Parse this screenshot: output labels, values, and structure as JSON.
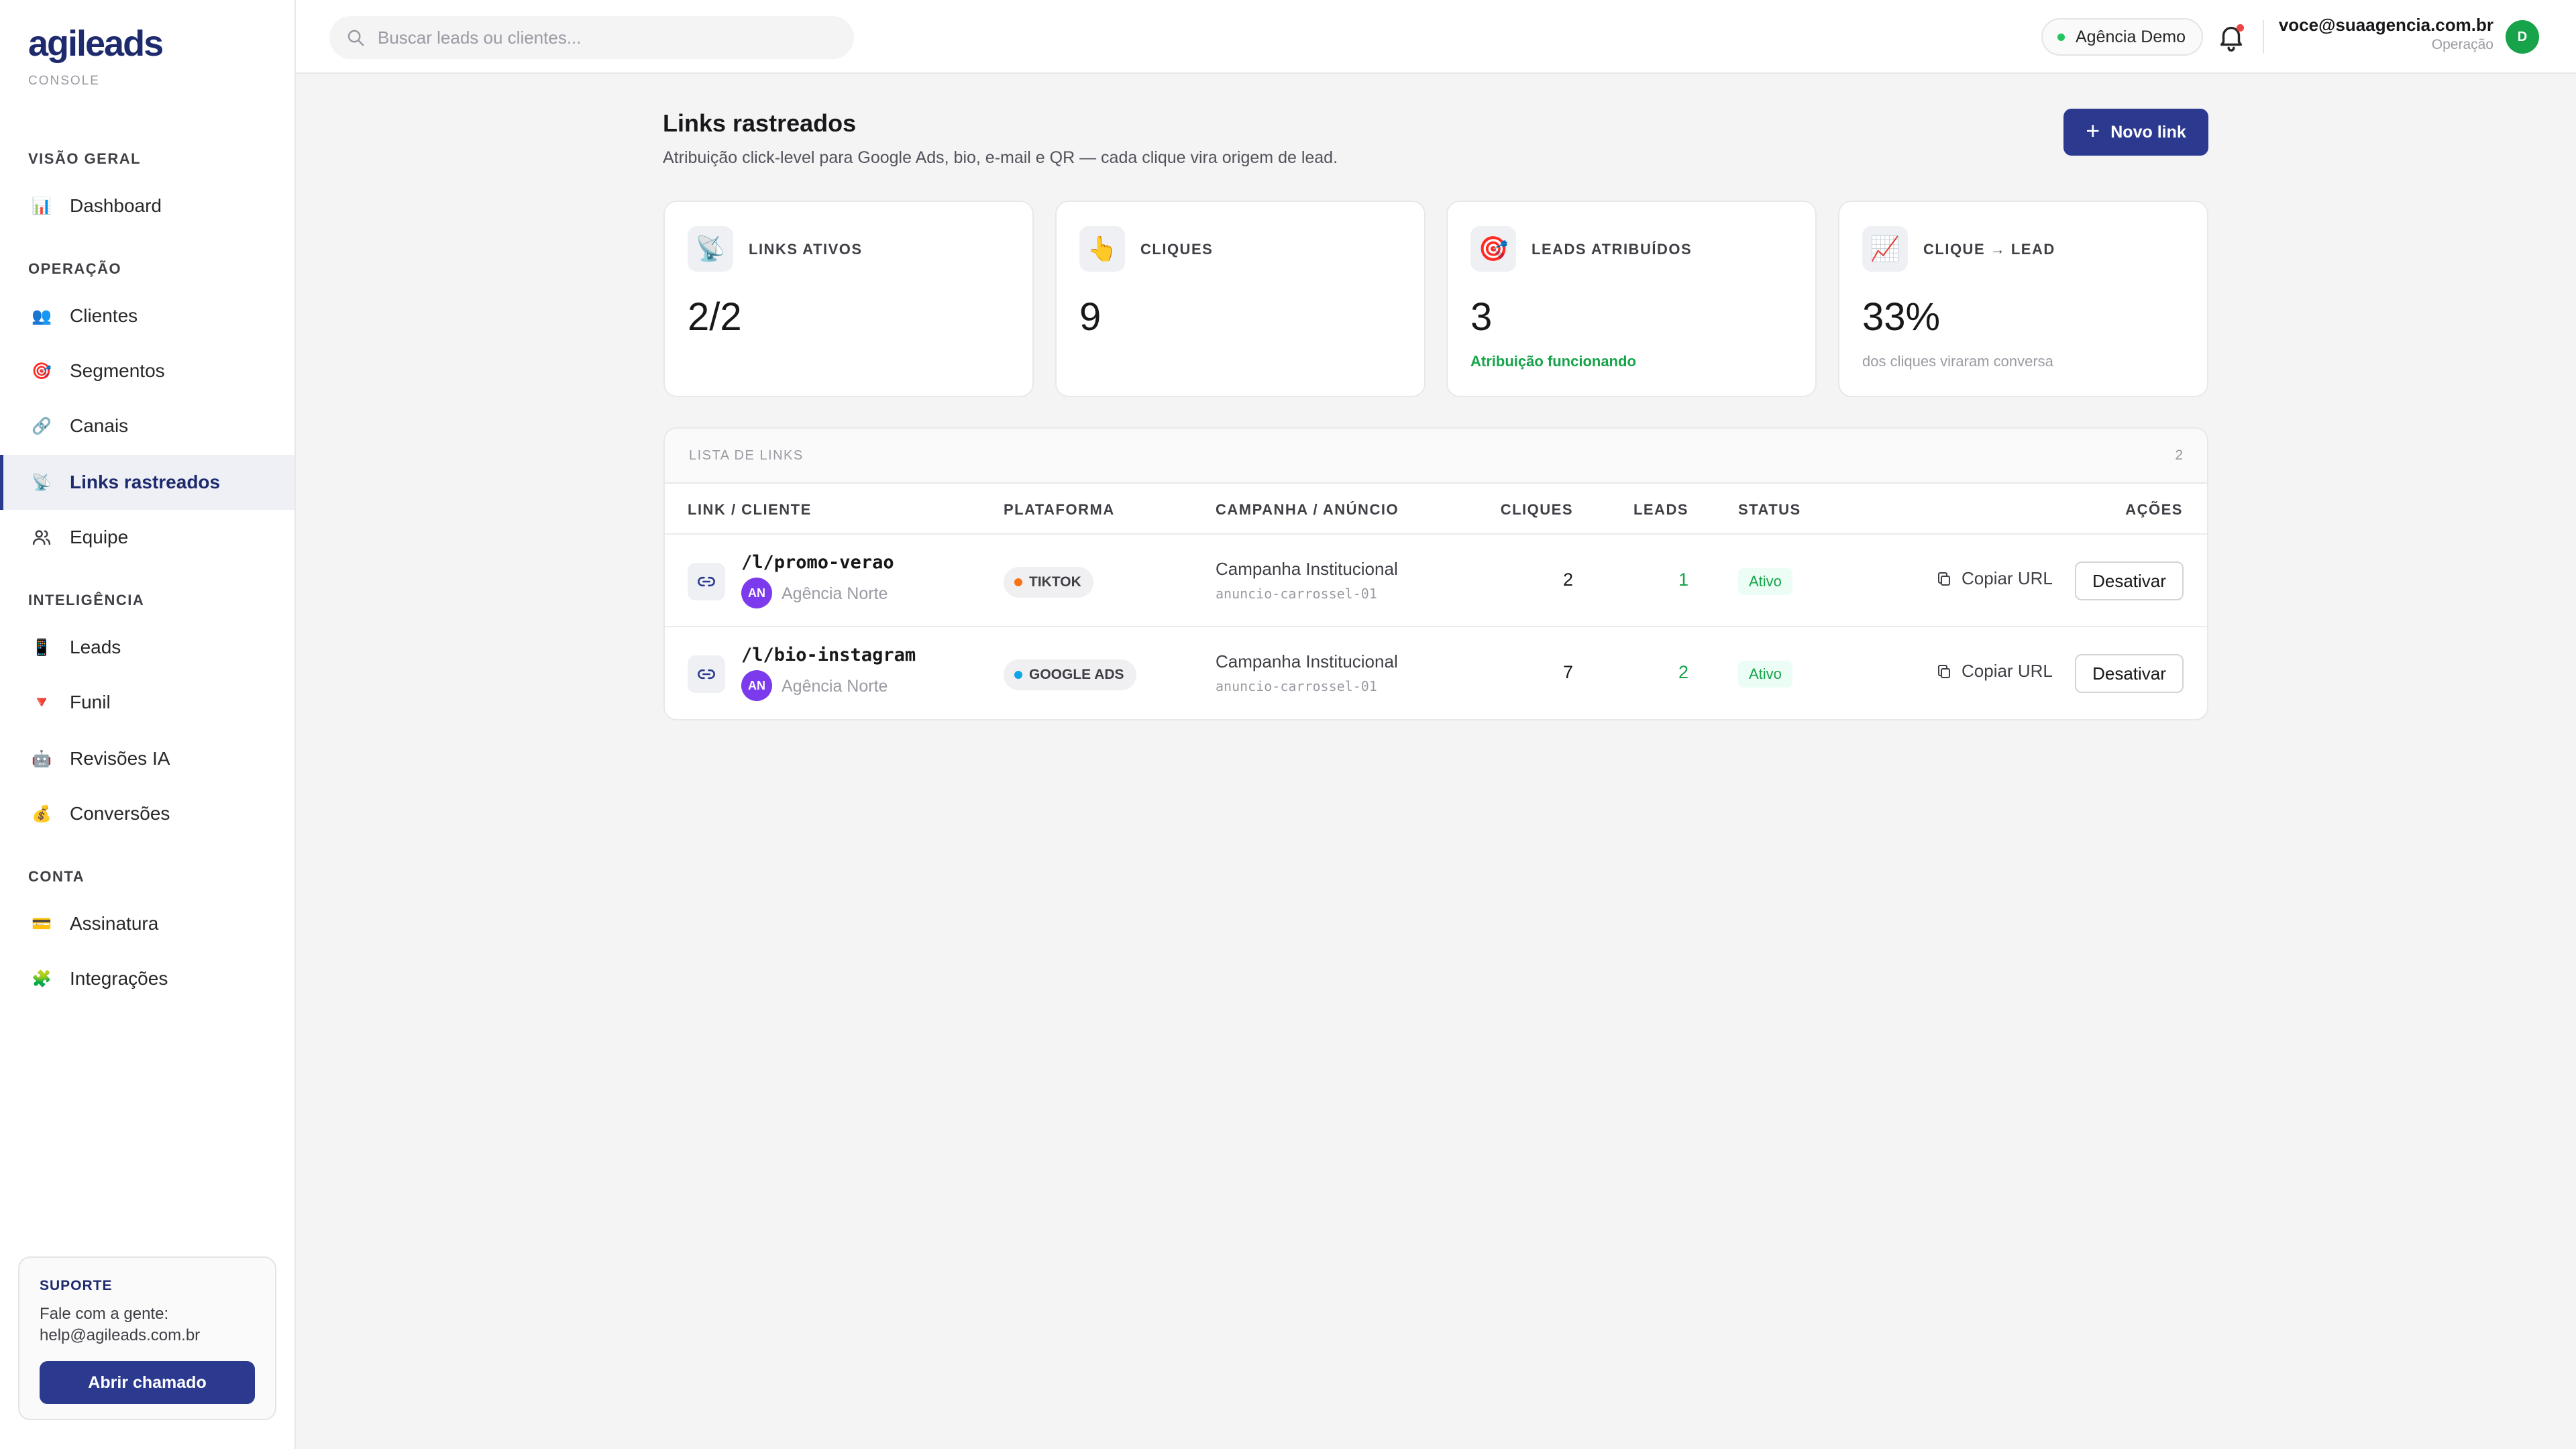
{
  "brand": {
    "logo": "agileads",
    "subtitle": "CONSOLE"
  },
  "sidebar": {
    "sections": [
      {
        "title": "VISÃO GERAL"
      },
      {
        "title": "OPERAÇÃO"
      },
      {
        "title": "INTELIGÊNCIA"
      },
      {
        "title": "CONTA"
      }
    ],
    "items": [
      {
        "label": "Dashboard",
        "icon": "bar-chart-icon",
        "glyph": "📊"
      },
      {
        "label": "Clientes",
        "icon": "users-icon",
        "glyph": "👥"
      },
      {
        "label": "Segmentos",
        "icon": "target-icon",
        "glyph": "🎯"
      },
      {
        "label": "Canais",
        "icon": "chain-link-icon",
        "glyph": "🔗"
      },
      {
        "label": "Links rastreados",
        "icon": "satellite-icon",
        "glyph": "📡",
        "active": true
      },
      {
        "label": "Equipe",
        "icon": "team-icon",
        "glyph": ""
      },
      {
        "label": "Leads",
        "icon": "phone-icon",
        "glyph": "📱"
      },
      {
        "label": "Funil",
        "icon": "funnel-icon",
        "glyph": "🔻"
      },
      {
        "label": "Revisões IA",
        "icon": "robot-icon",
        "glyph": "🤖"
      },
      {
        "label": "Conversões",
        "icon": "money-bag-icon",
        "glyph": "💰"
      },
      {
        "label": "Assinatura",
        "icon": "credit-card-icon",
        "glyph": "💳"
      },
      {
        "label": "Integrações",
        "icon": "puzzle-icon",
        "glyph": "🧩"
      }
    ],
    "support": {
      "title": "SUPORTE",
      "text_line1": "Fale com a gente:",
      "text_line2": "help@agileads.com.br",
      "button": "Abrir chamado"
    }
  },
  "topbar": {
    "search_placeholder": "Buscar leads ou clientes...",
    "agency": "Agência Demo",
    "user_email": "voce@suaagencia.com.br",
    "user_role": "Operação",
    "user_initial": "D"
  },
  "main": {
    "title": "Links rastreados",
    "subtitle": "Atribuição click-level para Google Ads, bio, e-mail e QR — cada clique vira origem de lead.",
    "new_button": "Novo link",
    "stats": [
      {
        "label": "LINKS ATIVOS",
        "value": "2/2",
        "note": "",
        "icon": "satellite-icon",
        "glyph": "📡"
      },
      {
        "label": "CLIQUES",
        "value": "9",
        "note": "",
        "icon": "click-icon",
        "glyph": "👆"
      },
      {
        "label": "LEADS ATRIBUÍDOS",
        "value": "3",
        "note": "Atribuição funcionando",
        "icon": "target-icon",
        "glyph": "🎯"
      },
      {
        "label": "CLIQUE → LEAD",
        "value": "33%",
        "note": "dos cliques viraram conversa",
        "icon": "trend-up-icon",
        "glyph": "📈"
      }
    ],
    "table": {
      "title": "LISTA DE LINKS",
      "count": "2",
      "columns": [
        "LINK / CLIENTE",
        "PLATAFORMA",
        "CAMPANHA / ANÚNCIO",
        "CLIQUES",
        "LEADS",
        "STATUS",
        "AÇÕES"
      ],
      "rows": [
        {
          "path": "/l/promo-verao",
          "client_initials": "AN",
          "client": "Agência Norte",
          "platform": "TIKTOK",
          "platform_color": "#f97316",
          "campaign": "Campanha Institucional",
          "ad": "anuncio-carrossel-01",
          "clicks": "2",
          "leads": "1",
          "status": "Ativo",
          "copy": "Copiar URL",
          "deactivate": "Desativar"
        },
        {
          "path": "/l/bio-instagram",
          "client_initials": "AN",
          "client": "Agência Norte",
          "platform": "GOOGLE ADS",
          "platform_color": "#0ea5e9",
          "campaign": "Campanha Institucional",
          "ad": "anuncio-carrossel-01",
          "clicks": "7",
          "leads": "2",
          "status": "Ativo",
          "copy": "Copiar URL",
          "deactivate": "Desativar"
        }
      ]
    }
  },
  "colors": {
    "accent": "#2b3a8f",
    "success": "#16a34a",
    "avatar_client": "#7c3aed"
  }
}
